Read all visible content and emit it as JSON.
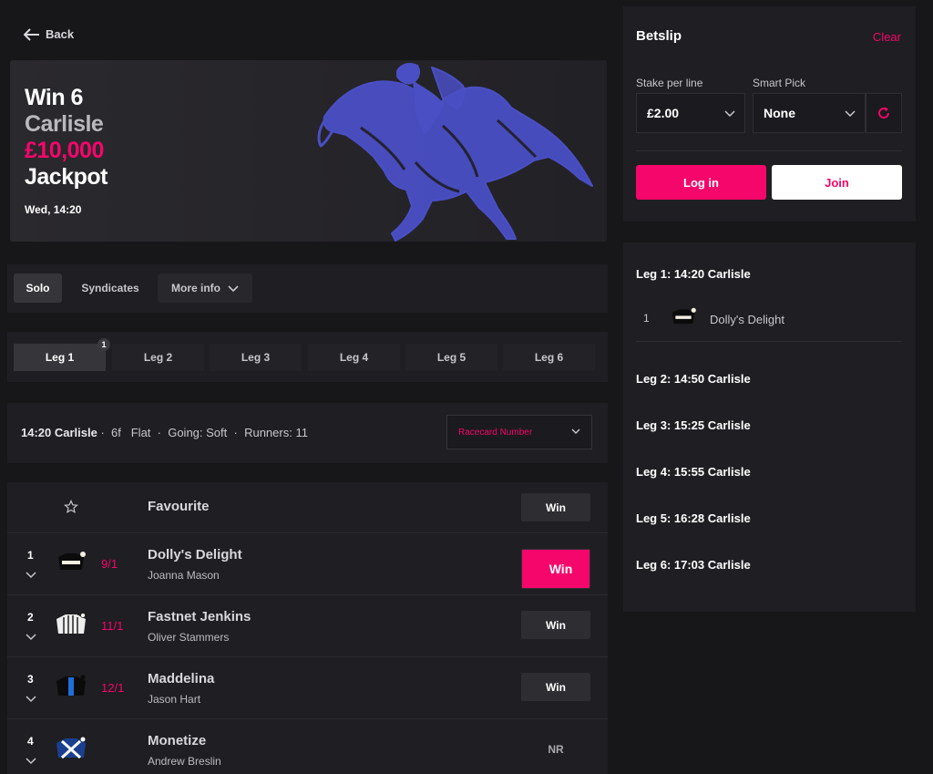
{
  "nav": {
    "back_label": "Back"
  },
  "hero": {
    "line1": "Win 6",
    "line2": "Carlisle",
    "line3": "£10,000",
    "line4": "Jackpot",
    "time": "Wed, 14:20"
  },
  "mode_tabs": {
    "solo": "Solo",
    "syndicates": "Syndicates",
    "more_info": "More info"
  },
  "legs": [
    {
      "label": "Leg 1",
      "badge": "1"
    },
    {
      "label": "Leg 2"
    },
    {
      "label": "Leg 3"
    },
    {
      "label": "Leg 4"
    },
    {
      "label": "Leg 5"
    },
    {
      "label": "Leg 6"
    }
  ],
  "race": {
    "time_course": "14:20 Carlisle",
    "sep1": "·",
    "distance": "6f",
    "type": "Flat",
    "going": "Going: Soft",
    "sep2": "·",
    "sep3": "·",
    "runners": "Runners: 11",
    "sort_selected": "Racecard Number"
  },
  "favourite_row": {
    "label": "Favourite",
    "win_label": "Win"
  },
  "runners": [
    {
      "num": "1",
      "odds": "9/1",
      "name": "Dolly's Delight",
      "jockey": "Joanna Mason",
      "action": "Win",
      "selected": true
    },
    {
      "num": "2",
      "odds": "11/1",
      "name": "Fastnet Jenkins",
      "jockey": "Oliver Stammers",
      "action": "Win"
    },
    {
      "num": "3",
      "odds": "12/1",
      "name": "Maddelina",
      "jockey": "Jason Hart",
      "action": "Win"
    },
    {
      "num": "4",
      "odds": "",
      "name": "Monetize",
      "jockey": "Andrew Breslin",
      "action": "NR"
    }
  ],
  "betslip": {
    "title": "Betslip",
    "clear": "Clear",
    "stake_label": "Stake per line",
    "stake_value": "£2.00",
    "smart_label": "Smart Pick",
    "smart_value": "None",
    "login": "Log in",
    "join": "Join"
  },
  "leg_summary": [
    {
      "title": "Leg 1: 14:20 Carlisle",
      "pick_num": "1",
      "pick_name": "Dolly's Delight"
    },
    {
      "title": "Leg 2: 14:50 Carlisle"
    },
    {
      "title": "Leg 3: 15:25 Carlisle"
    },
    {
      "title": "Leg 4: 15:55 Carlisle"
    },
    {
      "title": "Leg 5: 16:28 Carlisle"
    },
    {
      "title": "Leg 6: 17:03 Carlisle"
    }
  ],
  "colors": {
    "accent": "#f5066a",
    "background": "#171619",
    "panel": "#1f1e22",
    "horse_art": "#4a4fc4"
  },
  "icons": [
    "arrow-left-icon",
    "chevron-down-icon",
    "star-icon",
    "refresh-icon",
    "jockey-silk-icon",
    "horse-illustration"
  ]
}
